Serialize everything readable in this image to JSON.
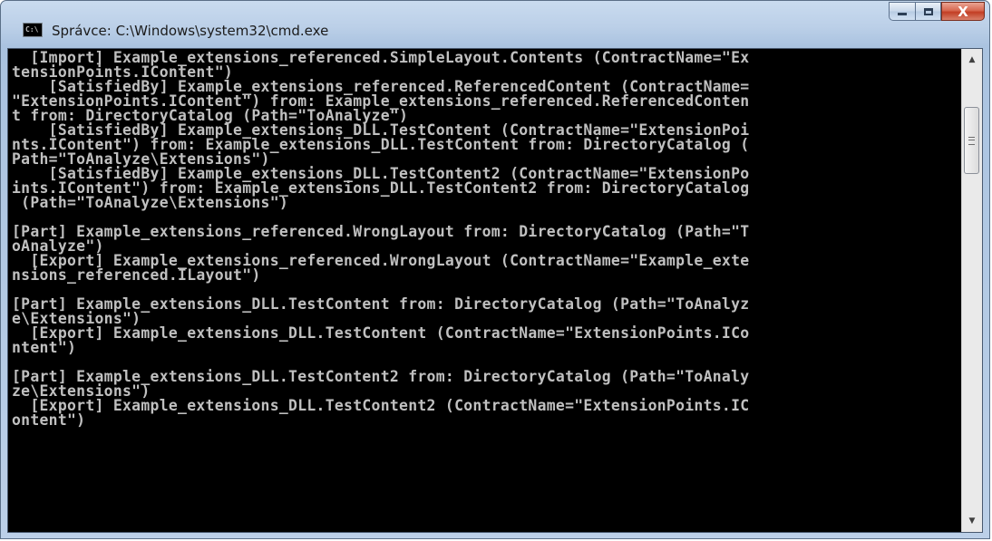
{
  "window": {
    "title": "Správce: C:\\Windows\\system32\\cmd.exe",
    "icon_text": "C:\\"
  },
  "controls": {
    "minimize_icon": "minimize-icon",
    "maximize_icon": "maximize-icon",
    "close_glyph": "X"
  },
  "scrollbar": {
    "up_glyph": "▲",
    "down_glyph": "▼"
  },
  "console": {
    "lines": [
      "  [Import] Example_extensions_referenced.SimpleLayout.Contents (ContractName=\"Ex",
      "tensionPoints.IContent\")",
      "    [SatisfiedBy] Example_extensions_referenced.ReferencedContent (ContractName=",
      "\"ExtensionPoints.IContent\") from: Example_extensions_referenced.ReferencedConten",
      "t from: DirectoryCatalog (Path=\"ToAnalyze\")",
      "    [SatisfiedBy] Example_extensions_DLL.TestContent (ContractName=\"ExtensionPoi",
      "nts.IContent\") from: Example_extensions_DLL.TestContent from: DirectoryCatalog (",
      "Path=\"ToAnalyze\\Extensions\")",
      "    [SatisfiedBy] Example_extensions_DLL.TestContent2 (ContractName=\"ExtensionPo",
      "ints.IContent\") from: Example_extensions_DLL.TestContent2 from: DirectoryCatalog",
      " (Path=\"ToAnalyze\\Extensions\")",
      "",
      "[Part] Example_extensions_referenced.WrongLayout from: DirectoryCatalog (Path=\"T",
      "oAnalyze\")",
      "  [Export] Example_extensions_referenced.WrongLayout (ContractName=\"Example_exte",
      "nsions_referenced.ILayout\")",
      "",
      "[Part] Example_extensions_DLL.TestContent from: DirectoryCatalog (Path=\"ToAnalyz",
      "e\\Extensions\")",
      "  [Export] Example_extensions_DLL.TestContent (ContractName=\"ExtensionPoints.ICo",
      "ntent\")",
      "",
      "[Part] Example_extensions_DLL.TestContent2 from: DirectoryCatalog (Path=\"ToAnaly",
      "ze\\Extensions\")",
      "  [Export] Example_extensions_DLL.TestContent2 (ContractName=\"ExtensionPoints.IC",
      "ontent\")",
      "",
      "",
      "",
      "",
      "",
      ""
    ]
  }
}
